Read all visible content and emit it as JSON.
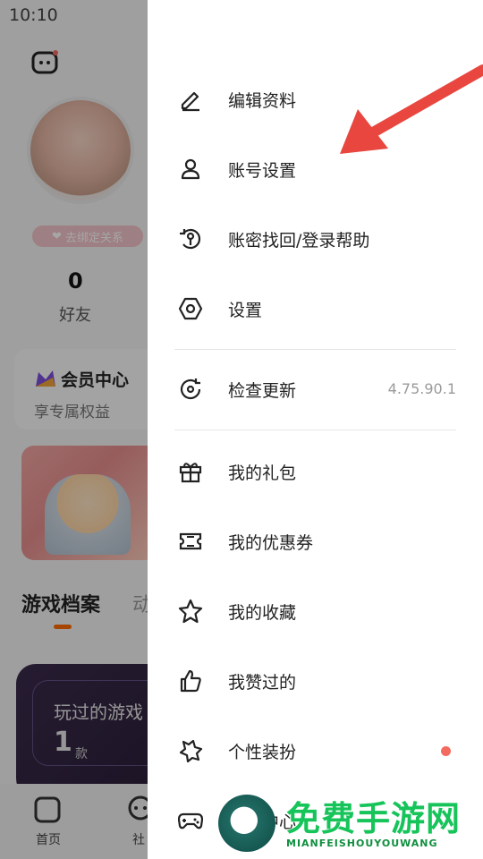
{
  "status_bar": {
    "time": "10:10"
  },
  "profile": {
    "bind_badge": "去绑定关系",
    "friends_count": "0",
    "friends_label": "好友",
    "member_center": {
      "title": "会员中心",
      "subtitle": "享专属权益"
    }
  },
  "profile_tabs": {
    "archive": "游戏档案",
    "more": "动"
  },
  "games_card": {
    "title": "玩过的游戏",
    "count": "1",
    "unit": "款"
  },
  "bottom_nav": {
    "home": "首页",
    "community": "社"
  },
  "drawer": {
    "items": [
      {
        "label": "编辑资料",
        "icon": "pencil-icon"
      },
      {
        "label": "账号设置",
        "icon": "user-icon"
      },
      {
        "label": "账密找回/登录帮助",
        "icon": "key-recovery-icon"
      },
      {
        "label": "设置",
        "icon": "settings-hexagon-icon"
      },
      {
        "label": "检查更新",
        "icon": "refresh-icon",
        "value": "4.75.90.1"
      },
      {
        "label": "我的礼包",
        "icon": "gift-icon"
      },
      {
        "label": "我的优惠券",
        "icon": "coupon-icon"
      },
      {
        "label": "我的收藏",
        "icon": "star-icon"
      },
      {
        "label": "我赞过的",
        "icon": "thumb-up-icon"
      },
      {
        "label": "个性装扮",
        "icon": "puzzle-icon",
        "badge": "dot"
      },
      {
        "label": "设备中心",
        "icon": "gamepad-icon"
      }
    ]
  },
  "watermark": {
    "title": "免费手游网",
    "subtitle": "MIANFEISHOUYOUWANG"
  },
  "colors": {
    "accent_orange": "#ff6a00",
    "dot_red": "#f36b5f",
    "arrow_red": "#e8463f",
    "watermark_green": "#16c45a"
  }
}
